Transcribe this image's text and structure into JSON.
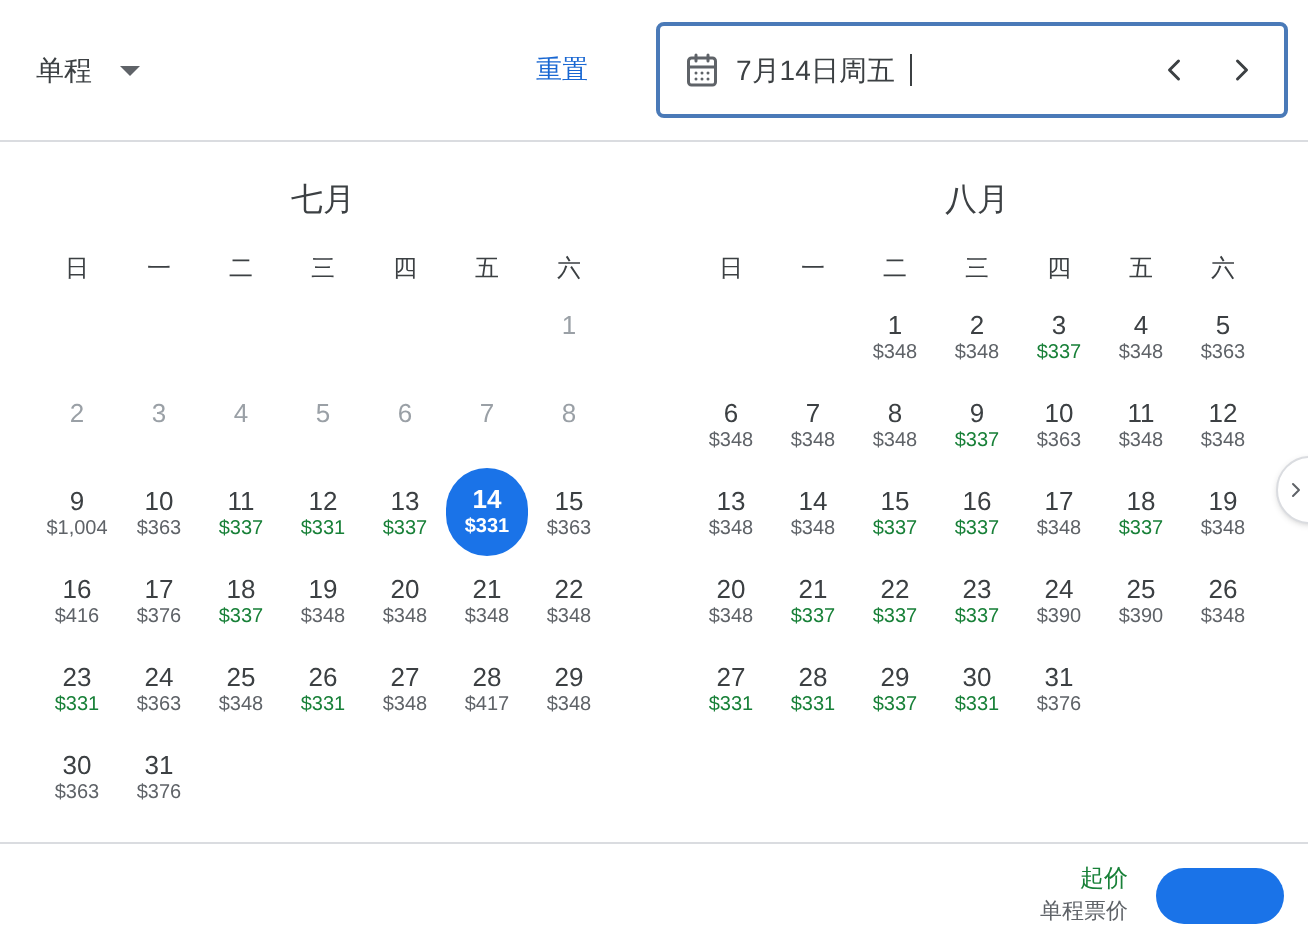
{
  "trip_type": {
    "label": "单程"
  },
  "reset_link": "重置",
  "date_field": {
    "value": "7月14日周五"
  },
  "months": [
    {
      "title": "七月",
      "weekdays": [
        "日",
        "一",
        "二",
        "三",
        "四",
        "五",
        "六"
      ],
      "weeks": [
        [
          {
            "day": "1",
            "disabled": true,
            "selected": false
          }
        ],
        [
          {
            "day": "2",
            "disabled": true,
            "selected": false
          },
          {
            "day": "3",
            "disabled": true,
            "selected": false
          },
          {
            "day": "4",
            "disabled": true,
            "selected": false
          },
          {
            "day": "5",
            "disabled": true,
            "selected": false
          },
          {
            "day": "6",
            "disabled": true,
            "selected": false
          },
          {
            "day": "7",
            "disabled": true,
            "selected": false
          },
          {
            "day": "8",
            "disabled": true,
            "selected": false
          }
        ],
        [
          {
            "day": "9",
            "price": "$1,004",
            "cheap": false,
            "disabled": false,
            "selected": false
          },
          {
            "day": "10",
            "price": "$363",
            "cheap": false,
            "disabled": false,
            "selected": false
          },
          {
            "day": "11",
            "price": "$337",
            "cheap": true,
            "disabled": false,
            "selected": false
          },
          {
            "day": "12",
            "price": "$331",
            "cheap": true,
            "disabled": false,
            "selected": false
          },
          {
            "day": "13",
            "price": "$337",
            "cheap": true,
            "disabled": false,
            "selected": false
          },
          {
            "day": "14",
            "price": "$331",
            "cheap": true,
            "disabled": false,
            "selected": true
          },
          {
            "day": "15",
            "price": "$363",
            "cheap": false,
            "disabled": false,
            "selected": false
          }
        ],
        [
          {
            "day": "16",
            "price": "$416",
            "cheap": false,
            "disabled": false,
            "selected": false
          },
          {
            "day": "17",
            "price": "$376",
            "cheap": false,
            "disabled": false,
            "selected": false
          },
          {
            "day": "18",
            "price": "$337",
            "cheap": true,
            "disabled": false,
            "selected": false
          },
          {
            "day": "19",
            "price": "$348",
            "cheap": false,
            "disabled": false,
            "selected": false
          },
          {
            "day": "20",
            "price": "$348",
            "cheap": false,
            "disabled": false,
            "selected": false
          },
          {
            "day": "21",
            "price": "$348",
            "cheap": false,
            "disabled": false,
            "selected": false
          },
          {
            "day": "22",
            "price": "$348",
            "cheap": false,
            "disabled": false,
            "selected": false
          }
        ],
        [
          {
            "day": "23",
            "price": "$331",
            "cheap": true,
            "disabled": false,
            "selected": false
          },
          {
            "day": "24",
            "price": "$363",
            "cheap": false,
            "disabled": false,
            "selected": false
          },
          {
            "day": "25",
            "price": "$348",
            "cheap": false,
            "disabled": false,
            "selected": false
          },
          {
            "day": "26",
            "price": "$331",
            "cheap": true,
            "disabled": false,
            "selected": false
          },
          {
            "day": "27",
            "price": "$348",
            "cheap": false,
            "disabled": false,
            "selected": false
          },
          {
            "day": "28",
            "price": "$417",
            "cheap": false,
            "disabled": false,
            "selected": false
          },
          {
            "day": "29",
            "price": "$348",
            "cheap": false,
            "disabled": false,
            "selected": false
          }
        ],
        [
          {
            "day": "30",
            "price": "$363",
            "cheap": false,
            "disabled": false,
            "selected": false
          },
          {
            "day": "31",
            "price": "$376",
            "cheap": false,
            "disabled": false,
            "selected": false
          }
        ]
      ]
    },
    {
      "title": "八月",
      "weekdays": [
        "日",
        "一",
        "二",
        "三",
        "四",
        "五",
        "六"
      ],
      "weeks": [
        [
          {
            "day": "1",
            "price": "$348",
            "cheap": false,
            "disabled": false,
            "selected": false
          },
          {
            "day": "2",
            "price": "$348",
            "cheap": false,
            "disabled": false,
            "selected": false
          },
          {
            "day": "3",
            "price": "$337",
            "cheap": true,
            "disabled": false,
            "selected": false
          },
          {
            "day": "4",
            "price": "$348",
            "cheap": false,
            "disabled": false,
            "selected": false
          },
          {
            "day": "5",
            "price": "$363",
            "cheap": false,
            "disabled": false,
            "selected": false
          }
        ],
        [
          {
            "day": "6",
            "price": "$348",
            "cheap": false,
            "disabled": false,
            "selected": false
          },
          {
            "day": "7",
            "price": "$348",
            "cheap": false,
            "disabled": false,
            "selected": false
          },
          {
            "day": "8",
            "price": "$348",
            "cheap": false,
            "disabled": false,
            "selected": false
          },
          {
            "day": "9",
            "price": "$337",
            "cheap": true,
            "disabled": false,
            "selected": false
          },
          {
            "day": "10",
            "price": "$363",
            "cheap": false,
            "disabled": false,
            "selected": false
          },
          {
            "day": "11",
            "price": "$348",
            "cheap": false,
            "disabled": false,
            "selected": false
          },
          {
            "day": "12",
            "price": "$348",
            "cheap": false,
            "disabled": false,
            "selected": false
          }
        ],
        [
          {
            "day": "13",
            "price": "$348",
            "cheap": false,
            "disabled": false,
            "selected": false
          },
          {
            "day": "14",
            "price": "$348",
            "cheap": false,
            "disabled": false,
            "selected": false
          },
          {
            "day": "15",
            "price": "$337",
            "cheap": true,
            "disabled": false,
            "selected": false
          },
          {
            "day": "16",
            "price": "$337",
            "cheap": true,
            "disabled": false,
            "selected": false
          },
          {
            "day": "17",
            "price": "$348",
            "cheap": false,
            "disabled": false,
            "selected": false
          },
          {
            "day": "18",
            "price": "$337",
            "cheap": true,
            "disabled": false,
            "selected": false
          },
          {
            "day": "19",
            "price": "$348",
            "cheap": false,
            "disabled": false,
            "selected": false
          }
        ],
        [
          {
            "day": "20",
            "price": "$348",
            "cheap": false,
            "disabled": false,
            "selected": false
          },
          {
            "day": "21",
            "price": "$337",
            "cheap": true,
            "disabled": false,
            "selected": false
          },
          {
            "day": "22",
            "price": "$337",
            "cheap": true,
            "disabled": false,
            "selected": false
          },
          {
            "day": "23",
            "price": "$337",
            "cheap": true,
            "disabled": false,
            "selected": false
          },
          {
            "day": "24",
            "price": "$390",
            "cheap": false,
            "disabled": false,
            "selected": false
          },
          {
            "day": "25",
            "price": "$390",
            "cheap": false,
            "disabled": false,
            "selected": false
          },
          {
            "day": "26",
            "price": "$348",
            "cheap": false,
            "disabled": false,
            "selected": false
          }
        ],
        [
          {
            "day": "27",
            "price": "$331",
            "cheap": true,
            "disabled": false,
            "selected": false
          },
          {
            "day": "28",
            "price": "$331",
            "cheap": true,
            "disabled": false,
            "selected": false
          },
          {
            "day": "29",
            "price": "$337",
            "cheap": true,
            "disabled": false,
            "selected": false
          },
          {
            "day": "30",
            "price": "$331",
            "cheap": true,
            "disabled": false,
            "selected": false
          },
          {
            "day": "31",
            "price": "$376",
            "cheap": false,
            "disabled": false,
            "selected": false
          }
        ]
      ]
    }
  ],
  "footer": {
    "price_label": "起价",
    "price_note": "单程票价"
  }
}
